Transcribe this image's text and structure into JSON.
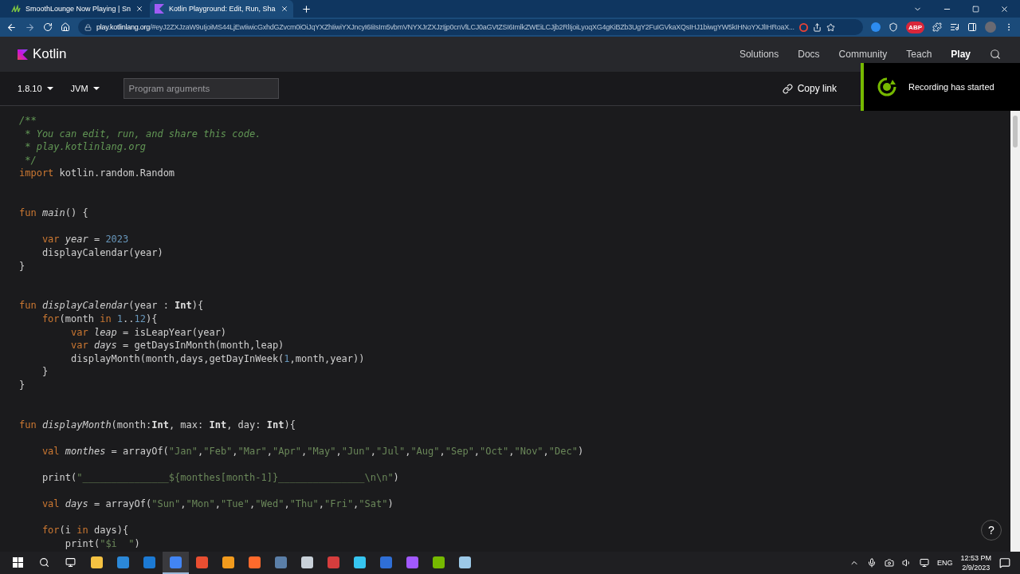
{
  "browser": {
    "tabs": [
      {
        "title": "SmoothLounge Now Playing | Sn",
        "selected": false
      },
      {
        "title": "Kotlin Playground: Edit, Run, Sha",
        "selected": true
      }
    ],
    "url_host": "play.kotlinlang.org",
    "url_rest": "/#eyJ2ZXJzaW9uIjoiMS44LjEwIiwicGxhdGZvcm0iOiJqYXZhIiwiYXJncyI6IiIsIm5vbmVNYXJrZXJzIjp0cnVlLCJ0aGVtZSI6ImlkZWEiLCJjb2RlIjoiLyoqXG4gKiBZb3UgY2FuIGVkaXQsIHJ1biwgYW5kIHNoYXJlIHRoaX...",
    "extension_badge": "ABP"
  },
  "site": {
    "logo": "Kotlin",
    "nav": [
      {
        "label": "Solutions",
        "selected": false
      },
      {
        "label": "Docs",
        "selected": false
      },
      {
        "label": "Community",
        "selected": false
      },
      {
        "label": "Teach",
        "selected": false
      },
      {
        "label": "Play",
        "selected": true
      }
    ]
  },
  "toolbar": {
    "version": "1.8.10",
    "target": "JVM",
    "args_placeholder": "Program arguments",
    "copy_link": "Copy link"
  },
  "code": [
    {
      "kind": "code",
      "tokens": [
        {
          "kind": "comment",
          "text": "/**"
        }
      ]
    },
    {
      "kind": "code",
      "tokens": [
        {
          "kind": "comment",
          "text": " * You can edit, run, and share this code."
        }
      ]
    },
    {
      "kind": "code",
      "tokens": [
        {
          "kind": "comment",
          "text": " * play.kotlinlang.org"
        }
      ]
    },
    {
      "kind": "code",
      "tokens": [
        {
          "kind": "comment",
          "text": " */"
        }
      ]
    },
    {
      "kind": "code",
      "tokens": [
        {
          "kind": "kw",
          "text": "import"
        },
        {
          "kind": "plain",
          "text": " kotlin.random.Random"
        }
      ]
    },
    {
      "kind": "blank"
    },
    {
      "kind": "blank"
    },
    {
      "kind": "code",
      "tokens": [
        {
          "kind": "kw",
          "text": "fun "
        },
        {
          "kind": "fn",
          "text": "main"
        },
        {
          "kind": "plain",
          "text": "() {"
        }
      ]
    },
    {
      "kind": "blank"
    },
    {
      "kind": "code",
      "tokens": [
        {
          "kind": "kw",
          "text": "    var "
        },
        {
          "kind": "var",
          "text": "year"
        },
        {
          "kind": "plain",
          "text": " = "
        },
        {
          "kind": "num",
          "text": "2023"
        }
      ]
    },
    {
      "kind": "code",
      "tokens": [
        {
          "kind": "plain",
          "text": "    displayCalendar(year)"
        }
      ]
    },
    {
      "kind": "code",
      "tokens": [
        {
          "kind": "plain",
          "text": "}"
        }
      ]
    },
    {
      "kind": "blank"
    },
    {
      "kind": "blank"
    },
    {
      "kind": "code",
      "tokens": [
        {
          "kind": "kw",
          "text": "fun "
        },
        {
          "kind": "fn",
          "text": "displayCalendar"
        },
        {
          "kind": "plain",
          "text": "(year : "
        },
        {
          "kind": "type",
          "text": "Int"
        },
        {
          "kind": "plain",
          "text": "){"
        }
      ]
    },
    {
      "kind": "code",
      "tokens": [
        {
          "kind": "kw",
          "text": "    for"
        },
        {
          "kind": "plain",
          "text": "(month "
        },
        {
          "kind": "kw",
          "text": "in "
        },
        {
          "kind": "num",
          "text": "1"
        },
        {
          "kind": "plain",
          "text": ".."
        },
        {
          "kind": "num",
          "text": "12"
        },
        {
          "kind": "plain",
          "text": "){"
        }
      ]
    },
    {
      "kind": "code",
      "tokens": [
        {
          "kind": "kw",
          "text": "         var "
        },
        {
          "kind": "var",
          "text": "leap"
        },
        {
          "kind": "plain",
          "text": " = isLeapYear(year)"
        }
      ]
    },
    {
      "kind": "code",
      "tokens": [
        {
          "kind": "kw",
          "text": "         var "
        },
        {
          "kind": "var",
          "text": "days"
        },
        {
          "kind": "plain",
          "text": " = getDaysInMonth(month,leap)"
        }
      ]
    },
    {
      "kind": "code",
      "tokens": [
        {
          "kind": "plain",
          "text": "         displayMonth(month,days,getDayInWeek("
        },
        {
          "kind": "num",
          "text": "1"
        },
        {
          "kind": "plain",
          "text": ",month,year))"
        }
      ]
    },
    {
      "kind": "code",
      "tokens": [
        {
          "kind": "plain",
          "text": "    }"
        }
      ]
    },
    {
      "kind": "code",
      "tokens": [
        {
          "kind": "plain",
          "text": "}"
        }
      ]
    },
    {
      "kind": "blank"
    },
    {
      "kind": "blank"
    },
    {
      "kind": "code",
      "tokens": [
        {
          "kind": "kw",
          "text": "fun "
        },
        {
          "kind": "fn",
          "text": "displayMonth"
        },
        {
          "kind": "plain",
          "text": "(month:"
        },
        {
          "kind": "type",
          "text": "Int"
        },
        {
          "kind": "plain",
          "text": ", max: "
        },
        {
          "kind": "type",
          "text": "Int"
        },
        {
          "kind": "plain",
          "text": ", day: "
        },
        {
          "kind": "type",
          "text": "Int"
        },
        {
          "kind": "plain",
          "text": "){"
        }
      ]
    },
    {
      "kind": "blank"
    },
    {
      "kind": "code",
      "tokens": [
        {
          "kind": "kw",
          "text": "    val "
        },
        {
          "kind": "var",
          "text": "monthes"
        },
        {
          "kind": "plain",
          "text": " = arrayOf("
        },
        {
          "kind": "str",
          "text": "\"Jan\""
        },
        {
          "kind": "plain",
          "text": ","
        },
        {
          "kind": "str",
          "text": "\"Feb\""
        },
        {
          "kind": "plain",
          "text": ","
        },
        {
          "kind": "str",
          "text": "\"Mar\""
        },
        {
          "kind": "plain",
          "text": ","
        },
        {
          "kind": "str",
          "text": "\"Apr\""
        },
        {
          "kind": "plain",
          "text": ","
        },
        {
          "kind": "str",
          "text": "\"May\""
        },
        {
          "kind": "plain",
          "text": ","
        },
        {
          "kind": "str",
          "text": "\"Jun\""
        },
        {
          "kind": "plain",
          "text": ","
        },
        {
          "kind": "str",
          "text": "\"Jul\""
        },
        {
          "kind": "plain",
          "text": ","
        },
        {
          "kind": "str",
          "text": "\"Aug\""
        },
        {
          "kind": "plain",
          "text": ","
        },
        {
          "kind": "str",
          "text": "\"Sep\""
        },
        {
          "kind": "plain",
          "text": ","
        },
        {
          "kind": "str",
          "text": "\"Oct\""
        },
        {
          "kind": "plain",
          "text": ","
        },
        {
          "kind": "str",
          "text": "\"Nov\""
        },
        {
          "kind": "plain",
          "text": ","
        },
        {
          "kind": "str",
          "text": "\"Dec\""
        },
        {
          "kind": "plain",
          "text": ")"
        }
      ]
    },
    {
      "kind": "blank"
    },
    {
      "kind": "code",
      "tokens": [
        {
          "kind": "plain",
          "text": "    print("
        },
        {
          "kind": "str",
          "text": "\"_______________${monthes[month-1]}_______________\\n\\n\""
        },
        {
          "kind": "plain",
          "text": ")"
        }
      ]
    },
    {
      "kind": "blank"
    },
    {
      "kind": "code",
      "tokens": [
        {
          "kind": "kw",
          "text": "    val "
        },
        {
          "kind": "var",
          "text": "days"
        },
        {
          "kind": "plain",
          "text": " = arrayOf("
        },
        {
          "kind": "str",
          "text": "\"Sun\""
        },
        {
          "kind": "plain",
          "text": ","
        },
        {
          "kind": "str",
          "text": "\"Mon\""
        },
        {
          "kind": "plain",
          "text": ","
        },
        {
          "kind": "str",
          "text": "\"Tue\""
        },
        {
          "kind": "plain",
          "text": ","
        },
        {
          "kind": "str",
          "text": "\"Wed\""
        },
        {
          "kind": "plain",
          "text": ","
        },
        {
          "kind": "str",
          "text": "\"Thu\""
        },
        {
          "kind": "plain",
          "text": ","
        },
        {
          "kind": "str",
          "text": "\"Fri\""
        },
        {
          "kind": "plain",
          "text": ","
        },
        {
          "kind": "str",
          "text": "\"Sat\""
        },
        {
          "kind": "plain",
          "text": ")"
        }
      ]
    },
    {
      "kind": "blank"
    },
    {
      "kind": "code",
      "tokens": [
        {
          "kind": "kw",
          "text": "    for"
        },
        {
          "kind": "plain",
          "text": "(i "
        },
        {
          "kind": "kw",
          "text": "in"
        },
        {
          "kind": "plain",
          "text": " days){"
        }
      ]
    },
    {
      "kind": "code",
      "tokens": [
        {
          "kind": "plain",
          "text": "        print("
        },
        {
          "kind": "str",
          "text": "\"$i  \""
        },
        {
          "kind": "plain",
          "text": ")"
        }
      ]
    }
  ],
  "help": "?",
  "toast": {
    "message": "Recording has started"
  },
  "taskbar": {
    "apps": [
      {
        "color": "#f5c242",
        "selected": false
      },
      {
        "color": "#2b88d8",
        "selected": false
      },
      {
        "color": "#1c7ad4",
        "selected": false
      },
      {
        "color": "#4285f4",
        "selected": true
      },
      {
        "color": "#e94e31",
        "selected": false
      },
      {
        "color": "#f29b1d",
        "selected": false
      },
      {
        "color": "#ff6a2c",
        "selected": false
      },
      {
        "color": "#5b7fa8",
        "selected": false
      },
      {
        "color": "#c9d1d9",
        "selected": false
      },
      {
        "color": "#d63d3d",
        "selected": false
      },
      {
        "color": "#36c5f0",
        "selected": false
      },
      {
        "color": "#2f6fd6",
        "selected": false
      },
      {
        "color": "#a259ff",
        "selected": false
      },
      {
        "color": "#76b900",
        "selected": false
      },
      {
        "color": "#9cc9e8",
        "selected": false
      }
    ],
    "language": "ENG",
    "time": "12:53 PM",
    "date": "2/9/2023"
  }
}
